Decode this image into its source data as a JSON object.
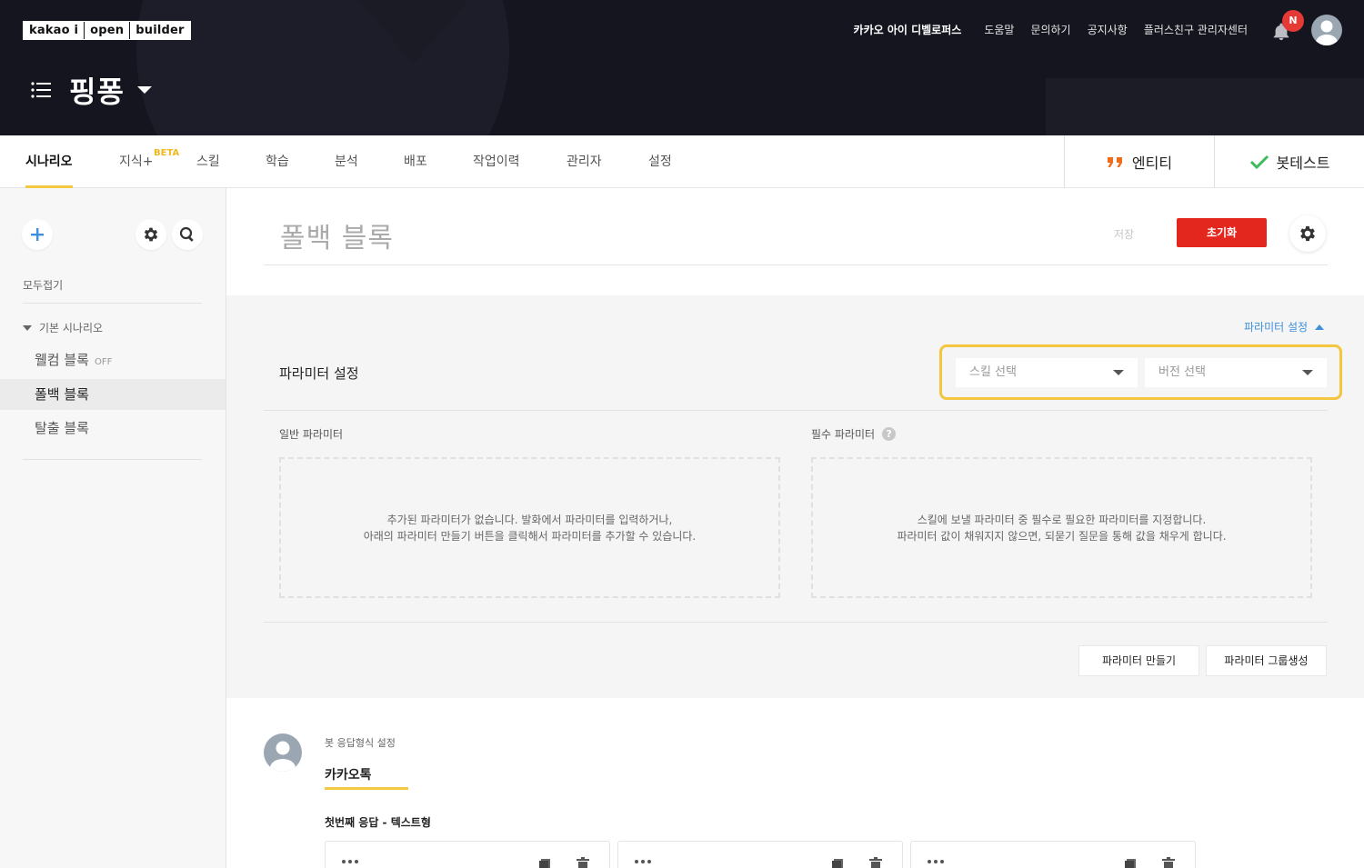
{
  "header": {
    "logo_parts": [
      "kakao i",
      "open",
      "builder"
    ],
    "links": [
      "카카오 아이 디벨로퍼스",
      "도움말",
      "문의하기",
      "공지사항",
      "플러스친구 관리자센터"
    ],
    "notification_badge": "N",
    "bot_name": "핑퐁"
  },
  "tabs": {
    "items": [
      "시나리오",
      "지식+",
      "스킬",
      "학습",
      "분석",
      "배포",
      "작업이력",
      "관리자",
      "설정"
    ],
    "beta_label": "BETA",
    "active": "시나리오",
    "entity_label": "엔티티",
    "bottest_label": "봇테스트"
  },
  "sidebar": {
    "collapse_all": "모두접기",
    "group_name": "기본 시나리오",
    "blocks": [
      {
        "name": "웰컴 블록",
        "tag": "OFF"
      },
      {
        "name": "폴백 블록",
        "tag": ""
      },
      {
        "name": "탈출 블록",
        "tag": ""
      }
    ],
    "active_block": "폴백 블록"
  },
  "main": {
    "block_title": "폴백 블록",
    "save_label": "저장",
    "reset_label": "초기화",
    "param_toggle": "파라미터 설정",
    "param_heading": "파라미터 설정",
    "skill_select_placeholder": "스킬 선택",
    "version_select_placeholder": "버전 선택",
    "general_param_label": "일반 파라미터",
    "required_param_label": "필수 파라미터",
    "help_glyph": "?",
    "general_empty_line1": "추가된 파라미터가 없습니다. 발화에서 파라미터를 입력하거나,",
    "general_empty_line2": "아래의 파라미터 만들기 버튼을 클릭해서 파라미터를 추가할 수 있습니다.",
    "required_empty_line1": "스킬에 보낼 파라미터 중 필수로 필요한 파라미터를 지정합니다.",
    "required_empty_line2": "파라미터 값이 채워지지 않으면, 되묻기 질문을 통해 값을 채우게 합니다.",
    "create_param_label": "파라미터 만들기",
    "create_group_label": "파라미터 그룹생성",
    "response_format_label": "봇 응답형식 설정",
    "response_channel": "카카오톡",
    "first_response_label": "첫번째 응답 - 텍스트형"
  },
  "colors": {
    "header_bg": "#15151f",
    "accent_yellow": "#f4c842",
    "reset_red": "#e3261e",
    "link_blue": "#3e8fdc",
    "entity_orange": "#f26b1d",
    "bottest_green": "#3dbb5d"
  },
  "icons": [
    "menu-icon",
    "bell-icon",
    "plus-icon",
    "gear-icon",
    "search-icon",
    "quote-icon",
    "check-icon",
    "copy-icon",
    "trash-icon"
  ]
}
